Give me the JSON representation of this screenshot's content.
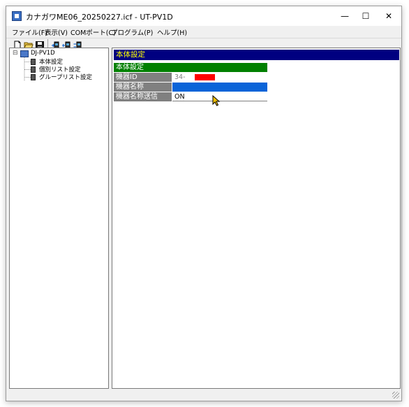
{
  "window": {
    "title": "カナガワME06_20250227.icf - UT-PV1D",
    "minimize_symbol": "—",
    "maximize_symbol": "☐",
    "close_symbol": "✕"
  },
  "menu": [
    "ファイル(F)",
    "表示(V)",
    "COMポート(C)",
    "プログラム(P)",
    "ヘルプ(H)"
  ],
  "toolbar": {
    "buttons": [
      "new-file-icon",
      "open-folder-icon",
      "save-icon",
      "read-radio-icon",
      "write-radio-icon",
      "transfer-radio-icon"
    ]
  },
  "tree": {
    "toggle": "⊟",
    "root": "DJ-PV1D",
    "children": [
      "本体設定",
      "個別リスト設定",
      "グループリスト設定"
    ]
  },
  "panel": {
    "header": "本体設定",
    "section": "本体設定",
    "rows": [
      {
        "label": "機器ID",
        "value": "34-"
      },
      {
        "label": "機器名称",
        "value": ""
      },
      {
        "label": "機器名称送信",
        "value": "ON"
      }
    ]
  },
  "colors": {
    "header_bg": "#000080",
    "header_text": "#ffff00",
    "section_bg": "#008000",
    "label_bg": "#808080",
    "id_redaction": "#ff0000",
    "name_field": "#0a64d8"
  }
}
